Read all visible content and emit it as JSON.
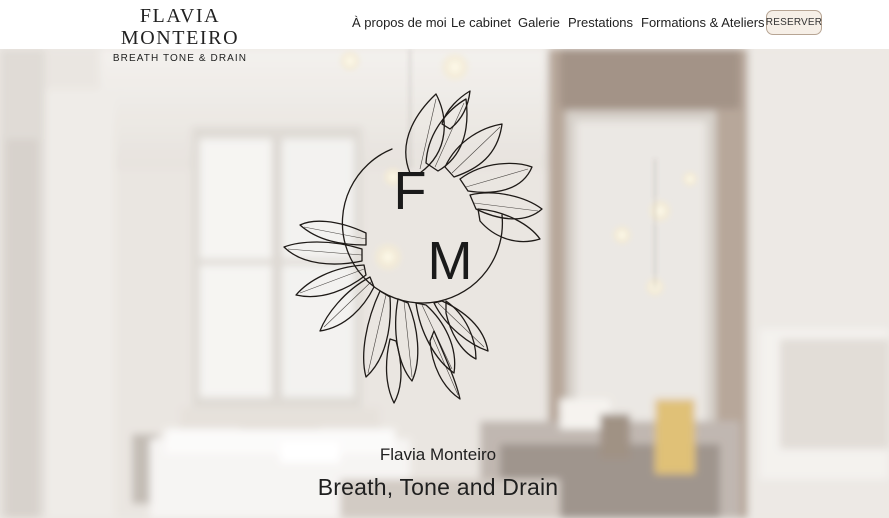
{
  "header": {
    "brand_name": "FLAVIA MONTEIRO",
    "brand_tagline": "BREATH TONE & DRAIN",
    "nav": [
      {
        "label": "À propos de moi"
      },
      {
        "label": "Le cabinet"
      },
      {
        "label": "Galerie"
      },
      {
        "label": "Prestations"
      },
      {
        "label": "Formations & Ateliers"
      }
    ],
    "reserve_label": "RESERVER"
  },
  "hero": {
    "logo_letters": [
      "F",
      "M"
    ],
    "name": "Flavia Monteiro",
    "tagline": "Breath, Tone and Drain"
  },
  "colors": {
    "text": "#222222",
    "reserve_bg": "#f6efe7",
    "reserve_border": "#b7a594",
    "wall": "#e9e4df",
    "brick": "#9e8a7b"
  },
  "icons": [
    "sunflower-logo-icon"
  ]
}
